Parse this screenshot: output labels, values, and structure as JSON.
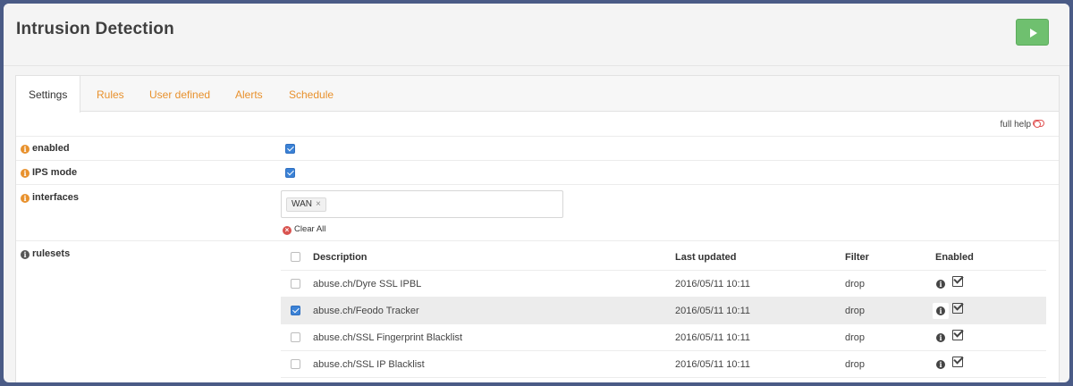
{
  "header": {
    "title": "Intrusion Detection"
  },
  "tabs": [
    {
      "label": "Settings",
      "active": true
    },
    {
      "label": "Rules",
      "active": false
    },
    {
      "label": "User defined",
      "active": false
    },
    {
      "label": "Alerts",
      "active": false
    },
    {
      "label": "Schedule",
      "active": false
    }
  ],
  "help": {
    "label": "full help"
  },
  "settings": {
    "enabled": {
      "label": "enabled",
      "checked": true
    },
    "ips_mode": {
      "label": "IPS mode",
      "checked": true
    },
    "interfaces": {
      "label": "interfaces",
      "selected": [
        "WAN"
      ],
      "chip_remove": "×",
      "clear_all": "Clear All"
    },
    "rulesets": {
      "label": "rulesets"
    }
  },
  "rulesets_table": {
    "columns": {
      "description": "Description",
      "last_updated": "Last updated",
      "filter": "Filter",
      "enabled": "Enabled"
    },
    "rows": [
      {
        "description": "abuse.ch/Dyre SSL IPBL",
        "last_updated": "2016/05/11 10:11",
        "filter": "drop",
        "selected": false
      },
      {
        "description": "abuse.ch/Feodo Tracker",
        "last_updated": "2016/05/11 10:11",
        "filter": "drop",
        "selected": true
      },
      {
        "description": "abuse.ch/SSL Fingerprint Blacklist",
        "last_updated": "2016/05/11 10:11",
        "filter": "drop",
        "selected": false
      },
      {
        "description": "abuse.ch/SSL IP Blacklist",
        "last_updated": "2016/05/11 10:11",
        "filter": "drop",
        "selected": false
      }
    ]
  },
  "colors": {
    "accent": "#e8912d",
    "run_button": "#6fc06f",
    "checkbox_on": "#3b82d6"
  }
}
